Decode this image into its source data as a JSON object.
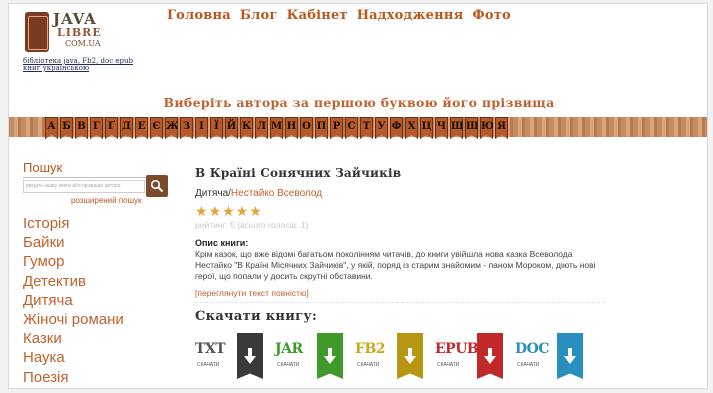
{
  "logo": {
    "line1": "JAVA",
    "line2": "LIBRE",
    "line3": "COM.UA",
    "caption": "бібліотека java, Fb2, doc epub книг українською"
  },
  "nav": [
    "Головна",
    "Блог",
    "Кабінет",
    "Надходження",
    "Фото"
  ],
  "alphabet": {
    "title": "Виберіть автора за першою буквою його прізвища",
    "letters": [
      "А",
      "Б",
      "В",
      "Г",
      "Ґ",
      "Д",
      "Е",
      "Є",
      "Ж",
      "З",
      "І",
      "Ї",
      "Й",
      "К",
      "Л",
      "М",
      "Н",
      "О",
      "П",
      "Р",
      "С",
      "Т",
      "У",
      "Ф",
      "Х",
      "Ц",
      "Ч",
      "Ш",
      "Щ",
      "Ю",
      "Я"
    ]
  },
  "sidebar": {
    "search_title": "Пошук",
    "search_placeholder": "введіть назву книги або прізвище автора",
    "advanced_search": "розширений пошук",
    "genres": [
      "Історія",
      "Байки",
      "Гумор",
      "Детектив",
      "Дитяча",
      "Жіночі романи",
      "Казки",
      "Наука",
      "Поезія"
    ]
  },
  "book": {
    "title": "В Країні Сонячних Зайчиків",
    "category": "Дитяча",
    "separator": "/",
    "author": "Нестайко Всеволод",
    "stars": 5,
    "rating_text": "рейтинг: 5 (всього голосів: 1)",
    "description_title": "Опис книги:",
    "description": "Крім казок, що вже відомі багатьом поколінням читачів, до книги увійшла нова казка Всеволода Нестайко \"В Країні Місячних Зайчиків\", у якій, поряд із старим знайомим - паном Мороком, діють нові герої, що попали у досить скрутні обставини.",
    "full_text_link": "[переглянути текст повністю]"
  },
  "downloads": {
    "title": "Скачати книгу:",
    "sub_label": "СКАЧАТИ",
    "items": [
      {
        "format": "TXT",
        "text_color": "#555555",
        "tag_color": "#3a3a3a"
      },
      {
        "format": "JAR",
        "text_color": "#3f9a2a",
        "tag_color": "#3f9a2a"
      },
      {
        "format": "FB2",
        "text_color": "#c7a81a",
        "tag_color": "#b89614"
      },
      {
        "format": "EPUB",
        "text_color": "#c0282a",
        "tag_color": "#c0282a"
      },
      {
        "format": "DOC",
        "text_color": "#2a8fbf",
        "tag_color": "#2a8fbf"
      }
    ]
  }
}
